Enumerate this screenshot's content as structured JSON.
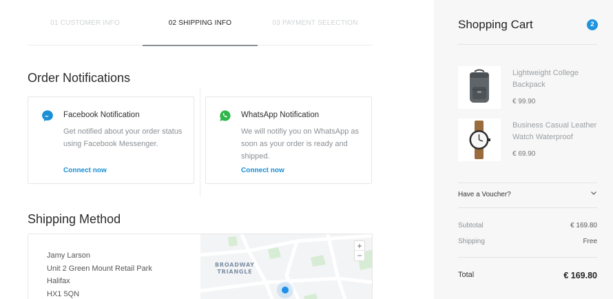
{
  "steps": [
    {
      "label": "01 CUSTOMER INFO",
      "active": false
    },
    {
      "label": "02 SHIPPING INFO",
      "active": true
    },
    {
      "label": "03 PAYMENT SELECTION",
      "active": false
    }
  ],
  "notifications": {
    "title": "Order Notifications",
    "facebook": {
      "title": "Facebook Notification",
      "description": "Get notified about your order status using Facebook Messenger.",
      "link": "Connect now",
      "icon": "messenger-icon",
      "color": "#1a8fd6"
    },
    "whatsapp": {
      "title": "WhatsApp Notification",
      "description": "We will notifiy you on WhatsApp as soon as your order is ready and shipped.",
      "link": "Connect now",
      "icon": "whatsapp-icon",
      "color": "#2fb64a"
    }
  },
  "shipping": {
    "title": "Shipping Method",
    "address": {
      "name": "Jamy Larson",
      "line1": "Unit 2 Green Mount Retail Park",
      "city": "Halifax",
      "postcode": "HX1 5QN"
    },
    "map": {
      "label_line1": "BROADWAY",
      "label_line2": "TRIANGLE",
      "zoom_in": "+",
      "zoom_out": "−"
    }
  },
  "cart": {
    "title": "Shopping Cart",
    "count": "2",
    "items": [
      {
        "name": "Lightweight College Backpack",
        "price": "€ 99.90",
        "icon": "backpack-image"
      },
      {
        "name": "Business Casual Leather Watch Waterproof",
        "price": "€ 69.90",
        "icon": "watch-image"
      }
    ],
    "voucher_label": "Have a Voucher?",
    "subtotal_label": "Subtotal",
    "subtotal_value": "€ 169.80",
    "shipping_label": "Shipping",
    "shipping_value": "Free",
    "total_label": "Total",
    "total_value": "€ 169.80"
  },
  "colors": {
    "accent": "#1f94dd",
    "link": "#1a8fd6",
    "map_pin": "#1f8fe8"
  }
}
